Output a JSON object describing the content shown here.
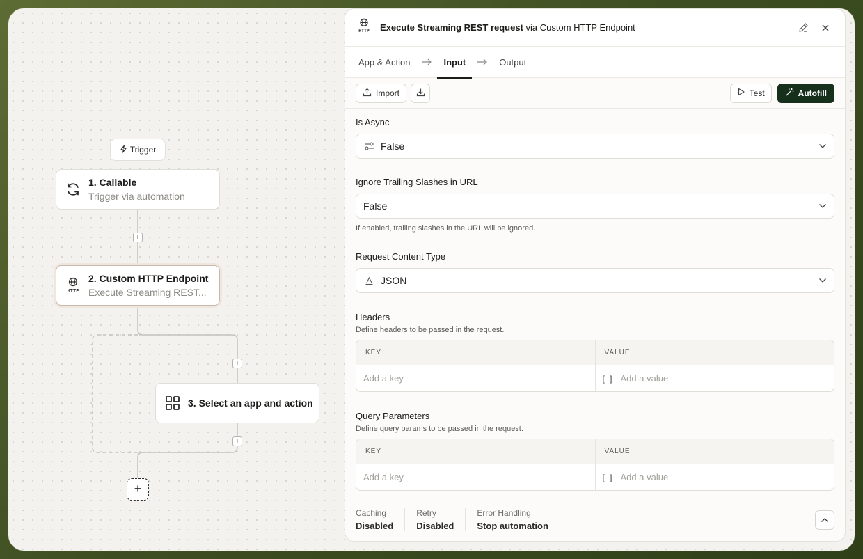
{
  "canvas": {
    "trigger_chip": "Trigger",
    "nodes": [
      {
        "title": "1. Callable",
        "subtitle": "Trigger via automation",
        "icon": "refresh-icon"
      },
      {
        "title": "2. Custom HTTP Endpoint",
        "subtitle": "Execute Streaming REST...",
        "icon": "http-globe-icon"
      },
      {
        "title": "3. Select an app and action",
        "icon": "grid-icon"
      }
    ],
    "add_step": "+"
  },
  "panel": {
    "icon": "http-globe-icon",
    "title_bold": "Execute Streaming REST request",
    "title_via": " via ",
    "title_app": "Custom HTTP Endpoint",
    "tabs": [
      {
        "label": "App & Action"
      },
      {
        "label": "Input",
        "active": true
      },
      {
        "label": "Output"
      }
    ],
    "toolbar": {
      "import_label": "Import",
      "test_label": "Test",
      "autofill_label": "Autofill"
    },
    "fields": {
      "is_async": {
        "label": "Is Async",
        "value": "False"
      },
      "ignore_trailing": {
        "label": "Ignore Trailing Slashes in URL",
        "value": "False",
        "help": "If enabled, trailing slashes in the URL will be ignored."
      },
      "content_type": {
        "label": "Request Content Type",
        "value": "JSON"
      },
      "headers": {
        "label": "Headers",
        "help": "Define headers to be passed in the request.",
        "key_header": "KEY",
        "value_header": "VALUE",
        "key_placeholder": "Add a key",
        "value_placeholder": "Add a value",
        "value_icon": "[ ]"
      },
      "query": {
        "label": "Query Parameters",
        "help": "Define query params to be passed in the request.",
        "key_header": "KEY",
        "value_header": "VALUE",
        "key_placeholder": "Add a key",
        "value_placeholder": "Add a value",
        "value_icon": "[ ]"
      }
    },
    "footer": {
      "caching_label": "Caching",
      "caching_value": "Disabled",
      "retry_label": "Retry",
      "retry_value": "Disabled",
      "error_label": "Error Handling",
      "error_value": "Stop automation"
    }
  },
  "colors": {
    "autofill_bg": "#17301c",
    "accent_border": "#c9b9ac",
    "outer_bg": "#3f4f22"
  }
}
